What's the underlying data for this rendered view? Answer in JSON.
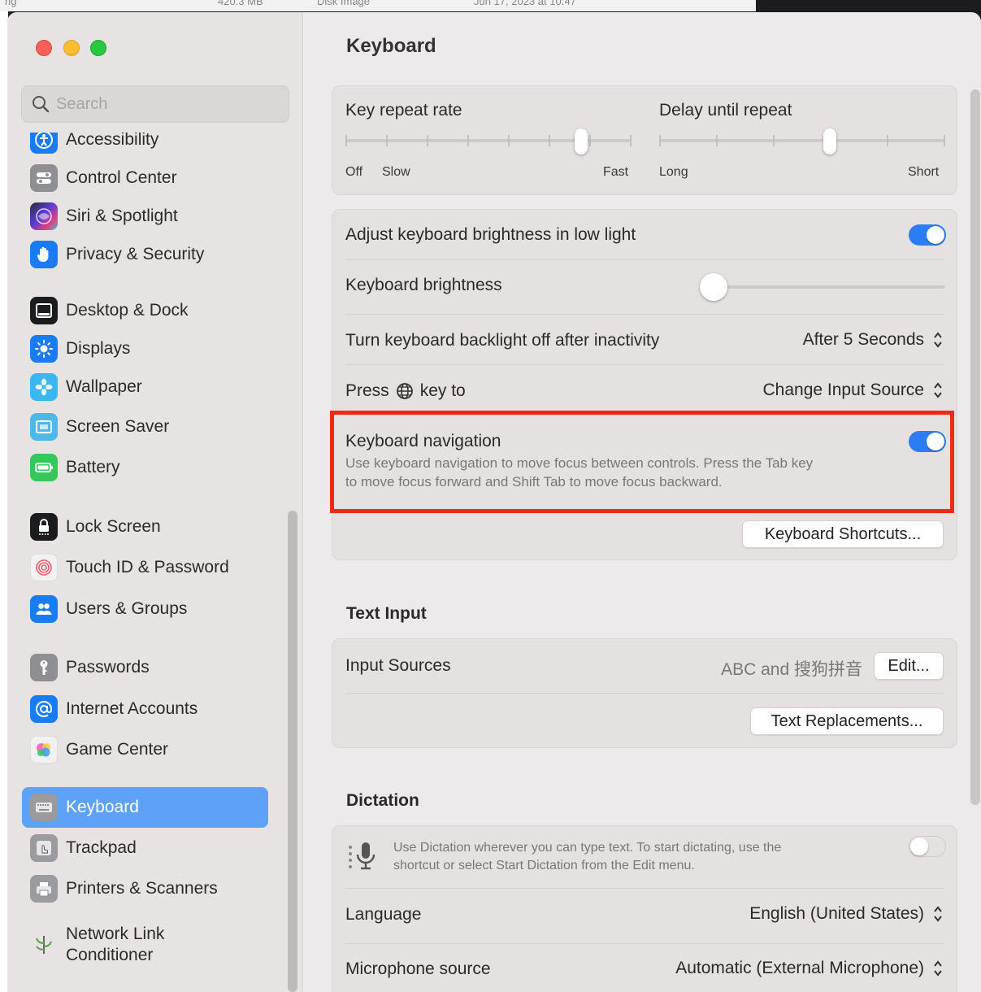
{
  "background": {
    "strip_text_1": "ng",
    "strip_text_2": "420.3 MB",
    "strip_text_3": "Disk Image",
    "strip_text_4": "Jun 17, 2023 at 10:47"
  },
  "search": {
    "placeholder": "Search"
  },
  "sidebar": {
    "items": [
      {
        "label": "Accessibility",
        "icon": "accessibility-icon",
        "color": "#1a7cf5"
      },
      {
        "label": "Control Center",
        "icon": "control-center-icon",
        "color": "#8e8e93"
      },
      {
        "label": "Siri & Spotlight",
        "icon": "siri-icon",
        "color": "#5a3dd8"
      },
      {
        "label": "Privacy & Security",
        "icon": "hand-icon",
        "color": "#1a7cf5"
      },
      {
        "label": "Desktop & Dock",
        "icon": "dock-icon",
        "color": "#1c1c1e"
      },
      {
        "label": "Displays",
        "icon": "sun-icon",
        "color": "#1a7cf5"
      },
      {
        "label": "Wallpaper",
        "icon": "flower-icon",
        "color": "#3ab7f0"
      },
      {
        "label": "Screen Saver",
        "icon": "screensaver-icon",
        "color": "#4fb8e8"
      },
      {
        "label": "Battery",
        "icon": "battery-icon",
        "color": "#34c759"
      },
      {
        "label": "Lock Screen",
        "icon": "lock-icon",
        "color": "#1c1c1e"
      },
      {
        "label": "Touch ID & Password",
        "icon": "fingerprint-icon",
        "color": "#f2f2f2"
      },
      {
        "label": "Users & Groups",
        "icon": "users-icon",
        "color": "#1a7cf5"
      },
      {
        "label": "Passwords",
        "icon": "key-icon",
        "color": "#8e8e93"
      },
      {
        "label": "Internet Accounts",
        "icon": "at-icon",
        "color": "#1a7cf5"
      },
      {
        "label": "Game Center",
        "icon": "game-center-icon",
        "color": "#f2f2f2"
      },
      {
        "label": "Keyboard",
        "icon": "keyboard-icon",
        "color": "#9a9a9f"
      },
      {
        "label": "Trackpad",
        "icon": "trackpad-icon",
        "color": "#9a9a9f"
      },
      {
        "label": "Printers & Scanners",
        "icon": "printer-icon",
        "color": "#9a9a9f"
      },
      {
        "label": "Network Link Conditioner",
        "icon": "network-link-icon",
        "color": "#e6e3e2"
      }
    ],
    "active_item": "Keyboard",
    "active_color": "#5ea1f8"
  },
  "main": {
    "title": "Keyboard",
    "key_repeat": {
      "label": "Key repeat rate",
      "min_label": "Off",
      "slow_label": "Slow",
      "max_label": "Fast",
      "value_fraction": 0.84
    },
    "delay_repeat": {
      "label": "Delay until repeat",
      "min_label": "Long",
      "max_label": "Short",
      "value_fraction": 0.6
    },
    "adjust_brightness": {
      "label": "Adjust keyboard brightness in low light",
      "enabled": true
    },
    "brightness": {
      "label": "Keyboard brightness",
      "value_fraction": 0.0
    },
    "backlight_off": {
      "label": "Turn keyboard backlight off after inactivity",
      "value": "After 5 Seconds"
    },
    "press_key": {
      "label_pre": "Press",
      "label_post": "key to",
      "value": "Change Input Source"
    },
    "keyboard_navigation": {
      "label": "Keyboard navigation",
      "enabled": true,
      "description_line1": "Use keyboard navigation to move focus between controls. Press the Tab key",
      "description_line2": "to move focus forward and Shift Tab to move focus backward."
    },
    "shortcuts_button": "Keyboard Shortcuts...",
    "text_input": {
      "title": "Text Input",
      "input_sources_label": "Input Sources",
      "input_sources_value": "ABC and 搜狗拼音",
      "edit_button": "Edit...",
      "text_replacements_button": "Text Replacements..."
    },
    "dictation": {
      "title": "Dictation",
      "description_line1": "Use Dictation wherever you can type text. To start dictating, use the",
      "description_line2": "shortcut or select Start Dictation from the Edit menu.",
      "enabled": false,
      "language_label": "Language",
      "language_value": "English (United States)",
      "mic_label": "Microphone source",
      "mic_value": "Automatic (External Microphone)"
    },
    "accent_color": "#2c7df5",
    "highlight_color": "#ee2a16"
  }
}
